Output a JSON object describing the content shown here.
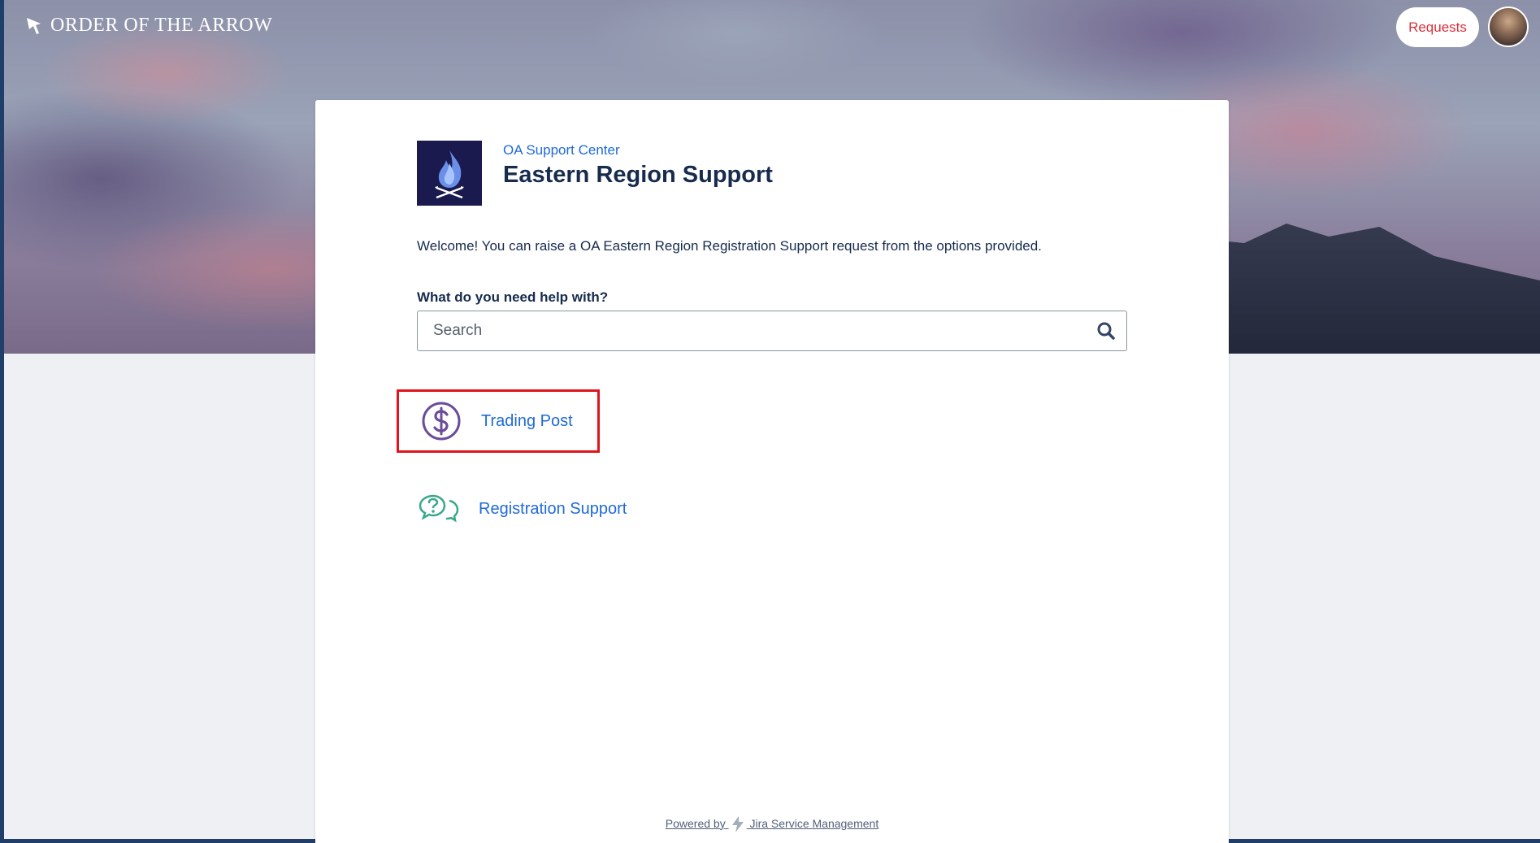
{
  "topbar": {
    "brand": "ORDER OF THE ARROW",
    "requests_label": "Requests",
    "avatar_icon": "user-avatar"
  },
  "portal": {
    "breadcrumb": "OA Support Center",
    "title": "Eastern Region Support",
    "welcome": "Welcome! You can raise a OA Eastern Region Registration Support request from the options provided.",
    "search_label": "What do you need help with?",
    "search_placeholder": "Search",
    "search_value": ""
  },
  "request_types": [
    {
      "label": "Trading Post",
      "icon": "dollar-circle-icon",
      "highlighted": true,
      "color": "#6b4c9a"
    },
    {
      "label": "Registration Support",
      "icon": "question-chat-icon",
      "highlighted": false,
      "color": "#3aa889"
    }
  ],
  "footer": {
    "powered_prefix": "Powered by",
    "product": "Jira Service Management"
  },
  "colors": {
    "link": "#1f6ad6",
    "title": "#172b4d",
    "highlight_border": "#e0141d",
    "requests_text": "#d6303d",
    "logo_bg": "#1b1a4e"
  }
}
